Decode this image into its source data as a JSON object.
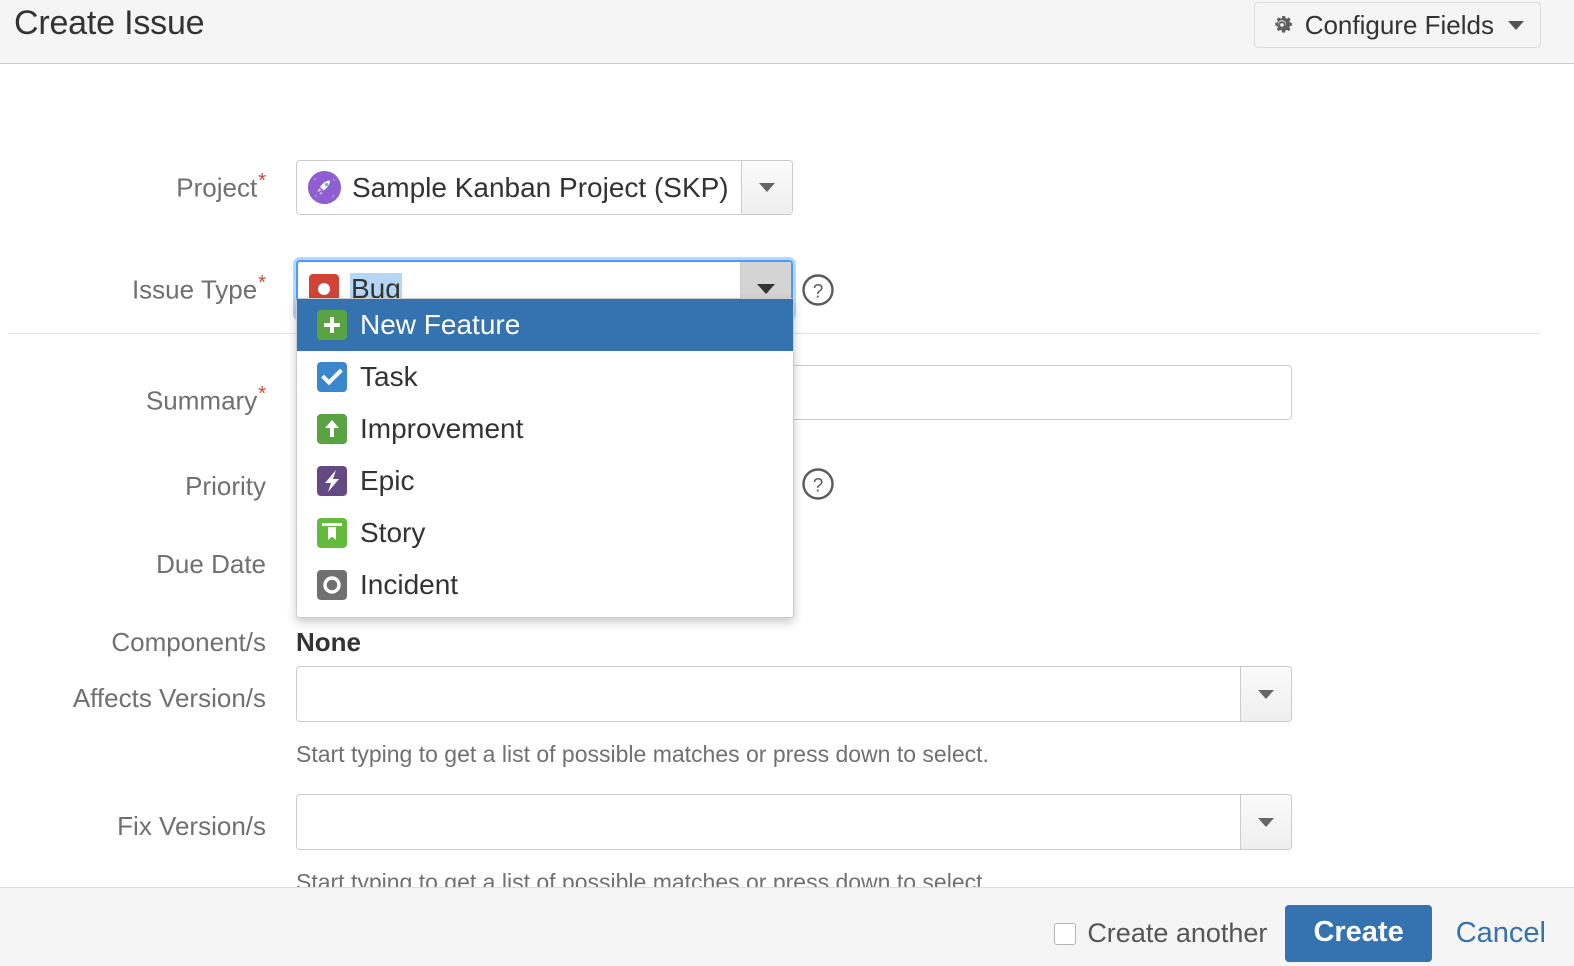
{
  "header": {
    "title": "Create Issue",
    "configure_fields_label": "Configure Fields",
    "gear_icon": "gear-icon",
    "caret_icon": "chevron-down-icon"
  },
  "form": {
    "project": {
      "label": "Project",
      "required": true,
      "value": "Sample Kanban Project (SKP)",
      "avatar_icon": "rocket-avatar-icon",
      "avatar_color": "#8f5ed0"
    },
    "issue_type": {
      "label": "Issue Type",
      "required": true,
      "value": "Bug",
      "value_selected": true,
      "icon": "bug-icon",
      "icon_color": "#d04437",
      "help_icon": "question-circle-icon",
      "expanded": true
    },
    "summary": {
      "label": "Summary",
      "required": true,
      "value": "",
      "placeholder": ""
    },
    "priority": {
      "label": "Priority",
      "required": false,
      "help_icon": "question-circle-icon"
    },
    "due_date": {
      "label": "Due Date",
      "required": false
    },
    "components": {
      "label": "Component/s",
      "value": "None"
    },
    "affects_versions": {
      "label": "Affects Version/s",
      "value": "",
      "hint": "Start typing to get a list of possible matches or press down to select."
    },
    "fix_versions": {
      "label": "Fix Version/s",
      "value": "",
      "hint": "Start typing to get a list of possible matches or press down to select."
    }
  },
  "issue_type_dropdown": {
    "options": [
      {
        "label": "New Feature",
        "icon": "plus-square-icon",
        "color": "#5aa342",
        "active": true
      },
      {
        "label": "Task",
        "icon": "check-square-icon",
        "color": "#3b87cd",
        "active": false
      },
      {
        "label": "Improvement",
        "icon": "arrow-up-square-icon",
        "color": "#5aa342",
        "active": false
      },
      {
        "label": "Epic",
        "icon": "bolt-square-icon",
        "color": "#654982",
        "active": false
      },
      {
        "label": "Story",
        "icon": "bookmark-square-icon",
        "color": "#63ba3c",
        "active": false
      },
      {
        "label": "Incident",
        "icon": "circle-square-icon",
        "color": "#707070",
        "active": false
      }
    ]
  },
  "footer": {
    "create_another_label": "Create another",
    "create_another_checked": false,
    "create_label": "Create",
    "cancel_label": "Cancel",
    "accent_color": "#3572b0"
  }
}
